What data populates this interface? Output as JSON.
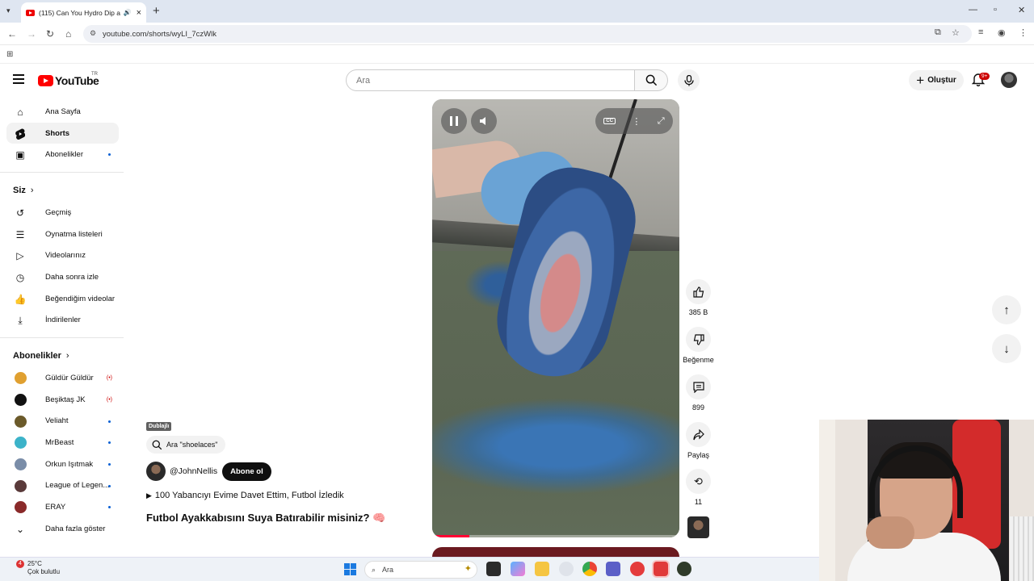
{
  "browser": {
    "tab_title": "(115) Can You Hydro Dip a",
    "url": "youtube.com/shorts/wyLI_7czWlk"
  },
  "header": {
    "search_placeholder": "Ara",
    "create_label": "Oluştur",
    "notif_count": "9+",
    "country": "TR",
    "logo_text": "YouTube"
  },
  "sidebar": {
    "main": [
      {
        "label": "Ana Sayfa",
        "icon": "home-icon"
      },
      {
        "label": "Shorts",
        "icon": "shorts-icon"
      },
      {
        "label": "Abonelikler",
        "icon": "subscriptions-icon"
      }
    ],
    "you_header": "Siz",
    "you": [
      {
        "label": "Geçmiş",
        "icon": "history-icon"
      },
      {
        "label": "Oynatma listeleri",
        "icon": "playlists-icon"
      },
      {
        "label": "Videolarınız",
        "icon": "your-videos-icon"
      },
      {
        "label": "Daha sonra izle",
        "icon": "watch-later-icon"
      },
      {
        "label": "Beğendiğim videolar",
        "icon": "liked-icon"
      },
      {
        "label": "İndirilenler",
        "icon": "download-icon"
      }
    ],
    "subs_header": "Abonelikler",
    "subs": [
      {
        "label": "Güldür Güldür",
        "live": true,
        "color": "#e0a030"
      },
      {
        "label": "Beşiktaş JK",
        "live": true,
        "color": "#111111"
      },
      {
        "label": "Veliaht",
        "live": false,
        "color": "#6b5a2a"
      },
      {
        "label": "MrBeast",
        "live": false,
        "color": "#3cb3c9"
      },
      {
        "label": "Orkun Işıtmak",
        "live": false,
        "color": "#7a8da8"
      },
      {
        "label": "League of Legen...",
        "live": false,
        "color": "#5a3a3a"
      },
      {
        "label": "ERAY",
        "live": false,
        "color": "#8a2a2a"
      }
    ],
    "show_more": "Daha fazla göster"
  },
  "short": {
    "dubbed_badge": "Dublajlı",
    "search_chip": "Ara \"shoelaces\"",
    "channel": "@JohnNellis",
    "subscribe": "Abone ol",
    "playlist": "100 Yabancıyı Evime Davet Ettim, Futbol İzledik",
    "title": "Futbol Ayakkabısını Suya Batırabilir misiniz? 🧠",
    "progress": 0.15
  },
  "actions": {
    "likes": "385 B",
    "dislike": "Beğenme",
    "comments": "899",
    "share": "Paylaş",
    "remix": "11"
  },
  "taskbar": {
    "weather_temp": "25°C",
    "weather_desc": "Çok bulutlu",
    "weather_badge": "4",
    "search": "Ara"
  }
}
